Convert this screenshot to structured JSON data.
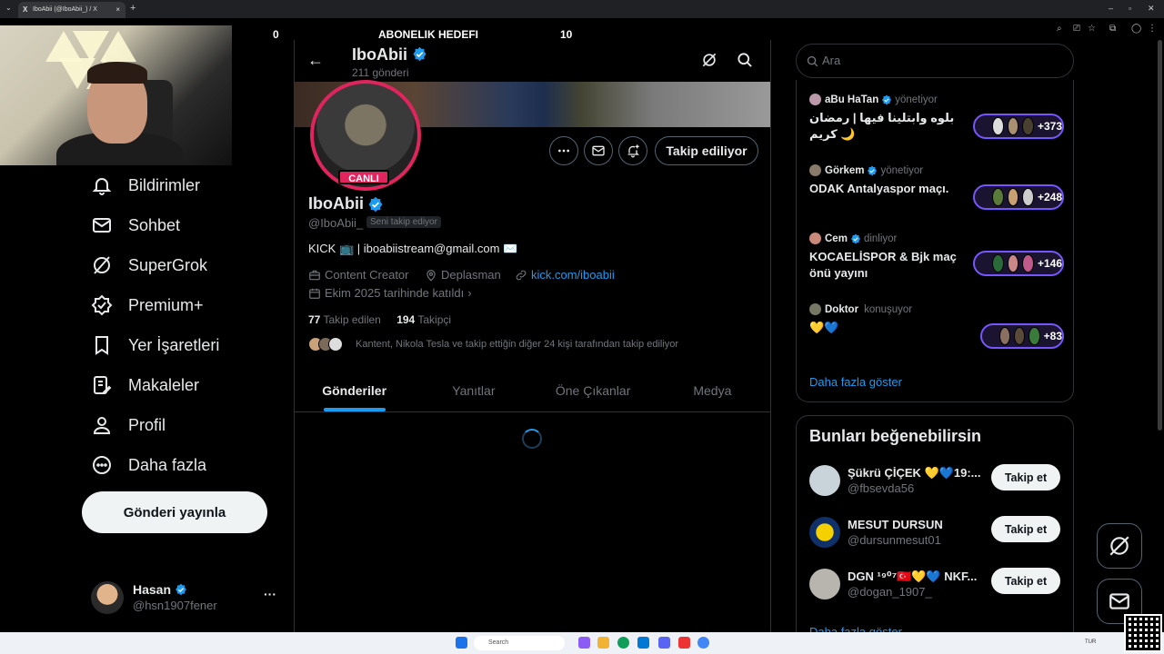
{
  "browser": {
    "tab_title": "IboAbii (@IboAbii_) / X",
    "tab_icon": "X",
    "new_tab": "+",
    "close": "×"
  },
  "overlay": {
    "goal_left": "0",
    "goal_label": "ABONELIK HEDEFI",
    "goal_right": "10"
  },
  "nav": {
    "items": [
      {
        "label": "Bildirimler",
        "icon": "bell-icon"
      },
      {
        "label": "Sohbet",
        "icon": "mail-icon"
      },
      {
        "label": "SuperGrok",
        "icon": "grok-icon"
      },
      {
        "label": "Premium+",
        "icon": "verified-icon"
      },
      {
        "label": "Yer İşaretleri",
        "icon": "bookmark-icon"
      },
      {
        "label": "Makaleler",
        "icon": "article-icon"
      },
      {
        "label": "Profil",
        "icon": "person-icon"
      },
      {
        "label": "Daha fazla",
        "icon": "more-circle-icon"
      }
    ],
    "post_button": "Gönderi yayınla"
  },
  "account": {
    "name": "Hasan",
    "handle": "@hsn1907fener",
    "more": "···"
  },
  "header": {
    "back": "←",
    "name": "IboAbii",
    "post_count": "211 gönderi"
  },
  "profile": {
    "live_badge": "CANLI",
    "follow_button": "Takip ediliyor",
    "name": "IboAbii",
    "handle": "@IboAbii_",
    "follows_you": "Seni takip ediyor",
    "bio": "KICK 📺 | iboabiistream@gmail.com ✉️",
    "category": "Content Creator",
    "location": "Deplasman",
    "link": "kick.com/iboabii",
    "joined": "Ekim 2025 tarihinde katıldı",
    "following_count": "77",
    "following_label": "Takip edilen",
    "followers_count": "194",
    "followers_label": "Takipçi",
    "followed_by": "Kantent, Nikola Tesla ve takip ettiğin diğer 24 kişi tarafından takip ediliyor"
  },
  "tabs": [
    "Gönderiler",
    "Yanıtlar",
    "Öne Çıkanlar",
    "Medya"
  ],
  "search": {
    "placeholder": "Ara"
  },
  "spaces": [
    {
      "host": "aBu HaTan",
      "role": "yönetiyor",
      "title": "بلوه وابتلينا فيها | رمضان كريم 🌙",
      "count": "+373"
    },
    {
      "host": "Görkem",
      "role": "yönetiyor",
      "title": "ODAK Antalyaspor maçı.",
      "count": "+248"
    },
    {
      "host": "Cem",
      "role": "dinliyor",
      "title": "KOCAELİSPOR & Bjk maç önü yayını",
      "count": "+146"
    },
    {
      "host": "Doktor",
      "role": "konuşuyor",
      "title": "💛💙",
      "count": "+83"
    }
  ],
  "spaces_show_more": "Daha fazla göster",
  "who_to_follow": {
    "title": "Bunları beğenebilirsin",
    "users": [
      {
        "name": "Şükrü ÇİÇEK 💛💙19:...",
        "handle": "@fbsevda56",
        "button": "Takip et"
      },
      {
        "name": "MESUT DURSUN",
        "handle": "@dursunmesut01",
        "button": "Takip et"
      },
      {
        "name": "DGN ¹⁹⁰⁷🇹🇷💛💙 NKF...",
        "handle": "@dogan_1907_",
        "button": "Takip et"
      }
    ],
    "show_more": "Daha fazla göster"
  },
  "taskbar": {
    "search": "Search",
    "lang": "TUR"
  },
  "colors": {
    "accent": "#1d9bf0",
    "live": "#e0245e",
    "space_pill": "#7856ff"
  }
}
